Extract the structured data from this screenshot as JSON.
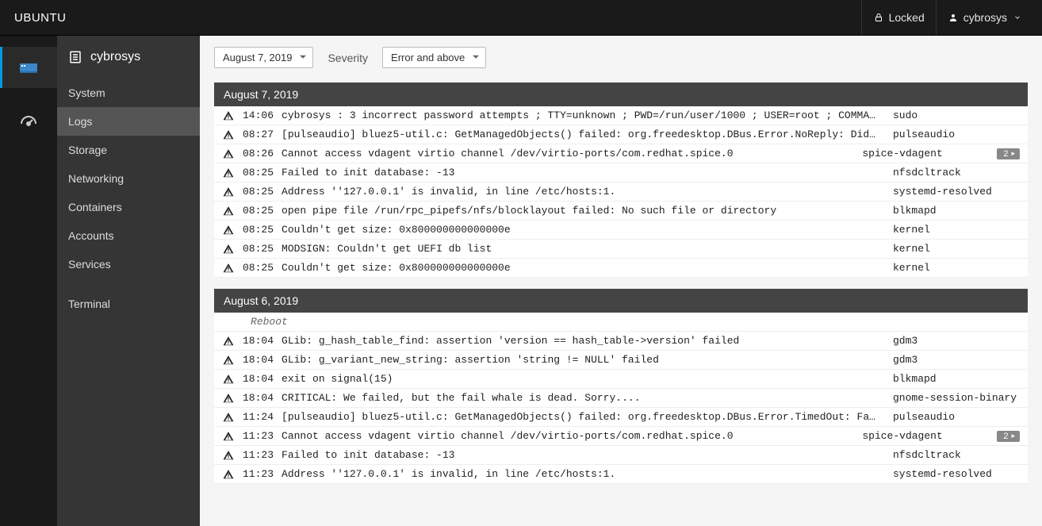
{
  "topbar": {
    "brand": "UBUNTU",
    "locked_label": "Locked",
    "user_label": "cybrosys"
  },
  "sidebar": {
    "host": "cybrosys",
    "items": [
      "System",
      "Logs",
      "Storage",
      "Networking",
      "Containers",
      "Accounts",
      "Services"
    ],
    "terminal": "Terminal",
    "active_index": 1
  },
  "toolbar": {
    "date_filter": "August 7, 2019",
    "severity_label": "Severity",
    "severity_filter": "Error and above"
  },
  "log_groups": [
    {
      "date": "August 7, 2019",
      "entries": [
        {
          "time": "14:06",
          "msg": "cybrosys : 3 incorrect password attempts ; TTY=unknown ; PWD=/run/user/1000 ; USER=root ; COMMA…",
          "src": "sudo"
        },
        {
          "time": "08:27",
          "msg": "[pulseaudio] bluez5-util.c: GetManagedObjects() failed: org.freedesktop.DBus.Error.NoReply: Did…",
          "src": "pulseaudio"
        },
        {
          "time": "08:26",
          "msg": "Cannot access vdagent virtio channel /dev/virtio-ports/com.redhat.spice.0",
          "src": "spice-vdagent",
          "badge": "2"
        },
        {
          "time": "08:25",
          "msg": "Failed to init database: -13",
          "src": "nfsdcltrack"
        },
        {
          "time": "08:25",
          "msg": "Address ''127.0.0.1' is invalid, in line /etc/hosts:1.",
          "src": "systemd-resolved"
        },
        {
          "time": "08:25",
          "msg": "open pipe file /run/rpc_pipefs/nfs/blocklayout failed: No such file or directory",
          "src": "blkmapd"
        },
        {
          "time": "08:25",
          "msg": "Couldn't get size: 0x800000000000000e",
          "src": "kernel"
        },
        {
          "time": "08:25",
          "msg": "MODSIGN: Couldn't get UEFI db list",
          "src": "kernel"
        },
        {
          "time": "08:25",
          "msg": "Couldn't get size: 0x800000000000000e",
          "src": "kernel"
        }
      ]
    },
    {
      "date": "August 6, 2019",
      "entries": [
        {
          "divider": true,
          "msg": "Reboot"
        },
        {
          "time": "18:04",
          "msg": "GLib: g_hash_table_find: assertion 'version == hash_table->version' failed",
          "src": "gdm3"
        },
        {
          "time": "18:04",
          "msg": "GLib: g_variant_new_string: assertion 'string != NULL' failed",
          "src": "gdm3"
        },
        {
          "time": "18:04",
          "msg": "exit on signal(15)",
          "src": "blkmapd"
        },
        {
          "time": "18:04",
          "msg": "CRITICAL: We failed, but the fail whale is dead. Sorry....",
          "src": "gnome-session-binary"
        },
        {
          "time": "11:24",
          "msg": "[pulseaudio] bluez5-util.c: GetManagedObjects() failed: org.freedesktop.DBus.Error.TimedOut: Fa…",
          "src": "pulseaudio"
        },
        {
          "time": "11:23",
          "msg": "Cannot access vdagent virtio channel /dev/virtio-ports/com.redhat.spice.0",
          "src": "spice-vdagent",
          "badge": "2"
        },
        {
          "time": "11:23",
          "msg": "Failed to init database: -13",
          "src": "nfsdcltrack"
        },
        {
          "time": "11:23",
          "msg": "Address ''127.0.0.1' is invalid, in line /etc/hosts:1.",
          "src": "systemd-resolved"
        }
      ]
    }
  ]
}
